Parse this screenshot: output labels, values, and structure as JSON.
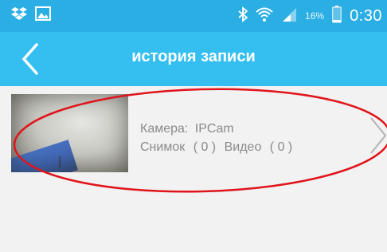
{
  "status_bar": {
    "battery_percent": "16%",
    "time": "0:30",
    "icons": [
      "dropbox-icon",
      "image-icon",
      "bluetooth-icon",
      "wifi-icon",
      "signal-icon",
      "battery-icon"
    ]
  },
  "app_bar": {
    "title": "история записи",
    "back_icon": "back-chevron-icon"
  },
  "records": [
    {
      "camera_label": "Камера:",
      "camera_name": "IPCam",
      "snapshots_label": "Снимок",
      "snapshots_count": "( 0 )",
      "videos_label": "Видео",
      "videos_count": "( 0 )"
    }
  ],
  "colors": {
    "status_bar": "#2aaee4",
    "app_bar": "#34bff0",
    "background": "#f2f2f2",
    "highlight_ellipse": "#e0141b"
  }
}
